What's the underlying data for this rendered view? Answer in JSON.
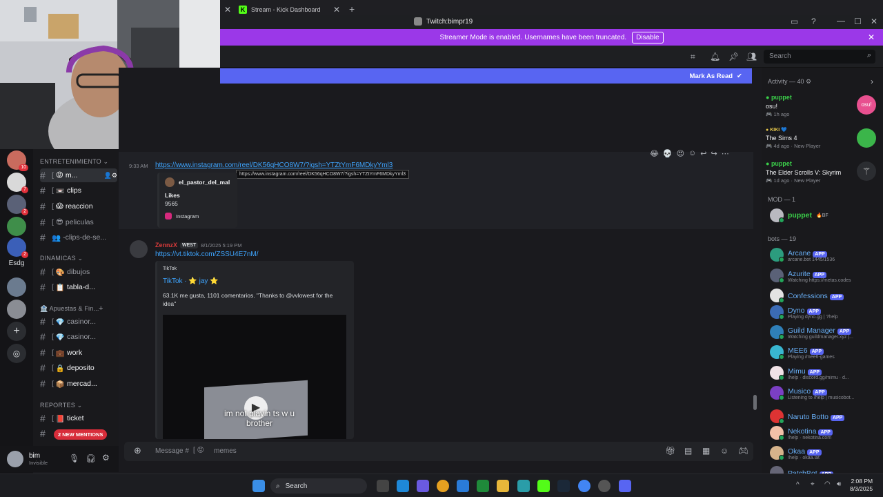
{
  "browser": {
    "tab_kick": "Stream - Kick Dashboard",
    "window_title": "Twitch:bimpr19"
  },
  "streamer_banner": {
    "text": "Streamer Mode is enabled. Usernames have been truncated.",
    "disable_label": "Disable"
  },
  "header": {
    "search_placeholder": "Search"
  },
  "mark_read": {
    "label": "Mark As Read"
  },
  "servers": {
    "badge_1": "10",
    "badge_2": "7",
    "badge_3": "2",
    "badge_4": "2",
    "text_server": "Esdg"
  },
  "sidebar": {
    "cat_entretenimiento": "ENTRETENIMIENTO",
    "cat_dinamicas": "DINAMICAS",
    "cat_apuestas": "Apuestas & Fin...",
    "cat_reportes": "REPORTES",
    "channels": {
      "memes": "m...",
      "clips": "clips",
      "reaccion": "reaccion",
      "peliculas": "peliculas",
      "clips_de_se": "-clips-de-se...",
      "dibujos": "dibujos",
      "tabla": "tabla-d...",
      "casino1": "casinor...",
      "casino2": "casinor...",
      "work": "work",
      "deposito": "deposito",
      "mercad": "mercad...",
      "ticket": "ticket"
    },
    "new_mentions": "2 NEW MENTIONS"
  },
  "user_panel": {
    "name": "bim",
    "status": "Invisible"
  },
  "chat": {
    "msg1": {
      "time": "9:33 AM",
      "link": "https://www.instagram.com/reel/DK56qHCO8W7/?igsh=YTZtYmF6MDkyYml3",
      "tooltip": "https://www.instagram.com/reel/DK56qHCO8W7/?igsh=YTZtYmF6MDkyYml3",
      "embed_author": "el_pastor_del_mal",
      "embed_field": "Likes",
      "embed_value": "9565",
      "embed_footer": "Instagram"
    },
    "msg2": {
      "author": "ZennzX",
      "tag": "WEST",
      "date": "8/1/2025 5:19 PM",
      "link": "https://vt.tiktok.com/ZSSU4E7nM/",
      "provider": "TikTok",
      "title": "TikTok · ⭐ jay ⭐",
      "description": "63.1K me gusta, 1101 comentarios. \"Thanks to @vvlowest for the idea\"",
      "video_caption": "im not playin ts w u brother"
    },
    "composer_placeholder": "Message #",
    "composer_channel": "memes"
  },
  "members": {
    "activity_header": "Activity — 40",
    "activities": [
      {
        "name": "puppet",
        "game": "osu!",
        "meta": "1h ago"
      },
      {
        "name": "KIKI",
        "game": "The Sims 4",
        "meta": "4d ago",
        "extra": "New Player"
      },
      {
        "name": "puppet",
        "game": "The Elder Scrolls V: Skyrim",
        "meta": "1d ago",
        "extra": "New Player"
      }
    ],
    "mod_header": "MOD — 1",
    "mod_name": "puppet",
    "mod_tag": "BF",
    "bots_header": "bots — 19",
    "app_tag": "APP",
    "bots": [
      {
        "name": "Arcane",
        "sub": "arcane.bot 1445/1536",
        "color": "#2c9c7e"
      },
      {
        "name": "Azurite",
        "sub": "Watching https://metas.codes",
        "color": "#5a6177"
      },
      {
        "name": "Confessions",
        "sub": "",
        "color": "#e3e3e3"
      },
      {
        "name": "Dyno",
        "sub": "Playing dyno.gg | ?help",
        "color": "#3b6bb5"
      },
      {
        "name": "Guild Manager",
        "sub": "Watching guildmanager.xyz |...",
        "color": "#2f7fb8"
      },
      {
        "name": "MEE6",
        "sub": "Playing /meе6-games",
        "color": "#39b6d0"
      },
      {
        "name": "Mimu",
        "sub": "/help · discord.gg/mimu · d...",
        "color": "#f1e2e6"
      },
      {
        "name": "Musico",
        "sub": "Listening to /help | musicobot...",
        "color": "#7b3fc4"
      },
      {
        "name": "Naruto Botto",
        "sub": "",
        "color": "#d33"
      },
      {
        "name": "Nekotina",
        "sub": "!help · nekotina.com",
        "color": "#f2c0a8"
      },
      {
        "name": "Okaa",
        "sub": "!help · okaa.lat",
        "color": "#d6b38b"
      },
      {
        "name": "PatchBot",
        "sub": "",
        "color": "#667"
      }
    ]
  },
  "taskbar": {
    "search_label": "Search",
    "time": "2:08 PM",
    "date": "8/3/2025"
  },
  "icons": [
    "close-icon",
    "plus-icon",
    "bell-icon",
    "pin-icon",
    "members-icon",
    "search-icon",
    "hash-icon",
    "mic-icon",
    "headphones-icon",
    "gear-icon",
    "gift-icon",
    "gif-icon",
    "sticker-icon",
    "emoji-icon",
    "play-icon",
    "windows-icon"
  ]
}
